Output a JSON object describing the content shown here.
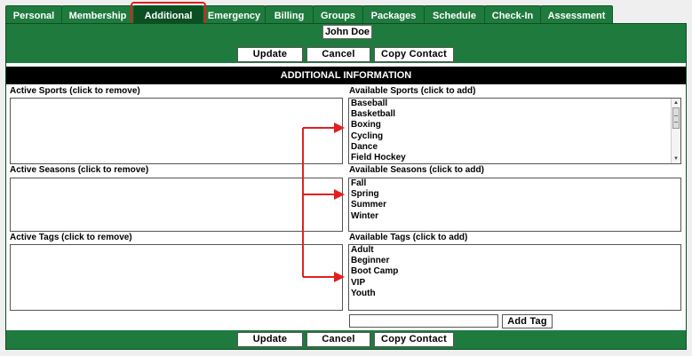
{
  "tabs": [
    {
      "label": "Personal",
      "active": false
    },
    {
      "label": "Membership",
      "active": false
    },
    {
      "label": "Additional",
      "active": true
    },
    {
      "label": "Emergency",
      "active": false
    },
    {
      "label": "Billing",
      "active": false
    },
    {
      "label": "Groups",
      "active": false
    },
    {
      "label": "Packages",
      "active": false
    },
    {
      "label": "Schedule",
      "active": false
    },
    {
      "label": "Check-In",
      "active": false
    },
    {
      "label": "Assessment",
      "active": false
    }
  ],
  "member_name": "John Doe",
  "actions": {
    "update": "Update",
    "cancel": "Cancel",
    "copy_contact": "Copy Contact"
  },
  "section_title": "ADDITIONAL INFORMATION",
  "sports": {
    "active_label": "Active Sports (click to remove)",
    "available_label": "Available Sports (click to add)",
    "active": [],
    "available": [
      "Baseball",
      "Basketball",
      "Boxing",
      "Cycling",
      "Dance",
      "Field Hockey"
    ]
  },
  "seasons": {
    "active_label": "Active Seasons (click to remove)",
    "available_label": "Available Seasons (click to add)",
    "active": [],
    "available": [
      "Fall",
      "Spring",
      "Summer",
      "Winter"
    ]
  },
  "tags": {
    "active_label": "Active Tags (click to remove)",
    "available_label": "Available Tags (click to add)",
    "active": [],
    "available": [
      "Adult",
      "Beginner",
      "Boot Camp",
      "VIP",
      "Youth"
    ],
    "new_tag_value": "",
    "add_tag_label": "Add Tag"
  },
  "colors": {
    "tab_bg": "#1f7a3e",
    "tab_active_bg": "#0b4f22",
    "highlight": "#e02020",
    "header_bg": "#000000"
  }
}
